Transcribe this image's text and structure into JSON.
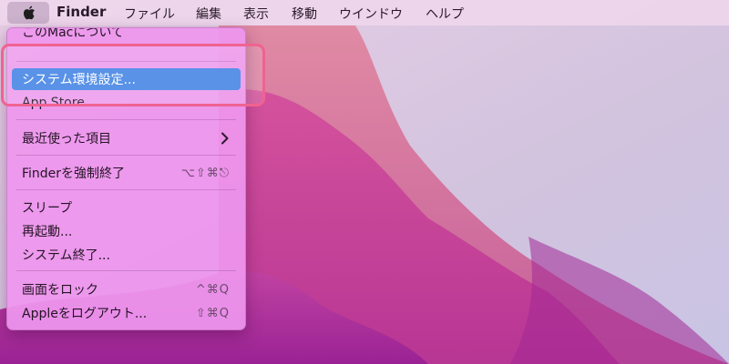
{
  "menubar": {
    "apple_icon": "apple-logo-icon",
    "app_name": "Finder",
    "items": [
      "ファイル",
      "編集",
      "表示",
      "移動",
      "ウインドウ",
      "ヘルプ"
    ]
  },
  "apple_menu": {
    "items": [
      {
        "label": "このMacについて"
      },
      {
        "label": "システム環境設定...",
        "highlighted": true
      },
      {
        "label": "App Store"
      },
      {
        "label": "最近使った項目",
        "submenu_icon": "chevron-right-icon"
      },
      {
        "label": "Finderを強制終了",
        "shortcut": "⌥⇧⌘⎋"
      },
      {
        "label": "スリープ"
      },
      {
        "label": "再起動..."
      },
      {
        "label": "システム終了..."
      },
      {
        "label": "画面をロック",
        "shortcut": "^⌘Q"
      },
      {
        "label": "Appleをログアウト...",
        "shortcut": "⇧⌘Q"
      }
    ]
  },
  "colors": {
    "highlight": "#3e80e4",
    "annotation": "#f06292",
    "menu_bg": "#ee96ee"
  }
}
